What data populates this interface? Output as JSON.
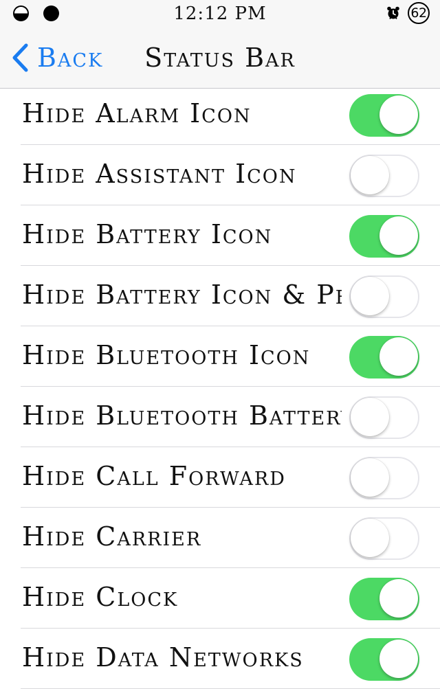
{
  "status_bar": {
    "time": "12:12 PM",
    "battery_percent": "62",
    "icons": [
      "signal-half-dot-icon",
      "signal-full-dot-icon",
      "alarm-clock-icon",
      "battery-circle-icon"
    ]
  },
  "nav": {
    "back_label": "Back",
    "title": "Status Bar",
    "back_icon": "chevron-left-icon"
  },
  "colors": {
    "accent": "#1a7cf0",
    "toggle_on": "#4cd964",
    "toggle_off_border": "#e5e5ea",
    "separator": "#d8d8dc",
    "topbar_bg": "#f7f7f7"
  },
  "settings": [
    {
      "label": "Hide Alarm Icon",
      "on": true
    },
    {
      "label": "Hide Assistant Icon",
      "on": false
    },
    {
      "label": "Hide Battery Icon",
      "on": true
    },
    {
      "label": "Hide Battery Icon & Perc...",
      "on": false
    },
    {
      "label": "Hide Bluetooth Icon",
      "on": true
    },
    {
      "label": "Hide Bluetooth Battery I...",
      "on": false
    },
    {
      "label": "Hide Call Forward",
      "on": false
    },
    {
      "label": "Hide Carrier",
      "on": false
    },
    {
      "label": "Hide Clock",
      "on": true
    },
    {
      "label": "Hide Data Networks",
      "on": true
    }
  ]
}
